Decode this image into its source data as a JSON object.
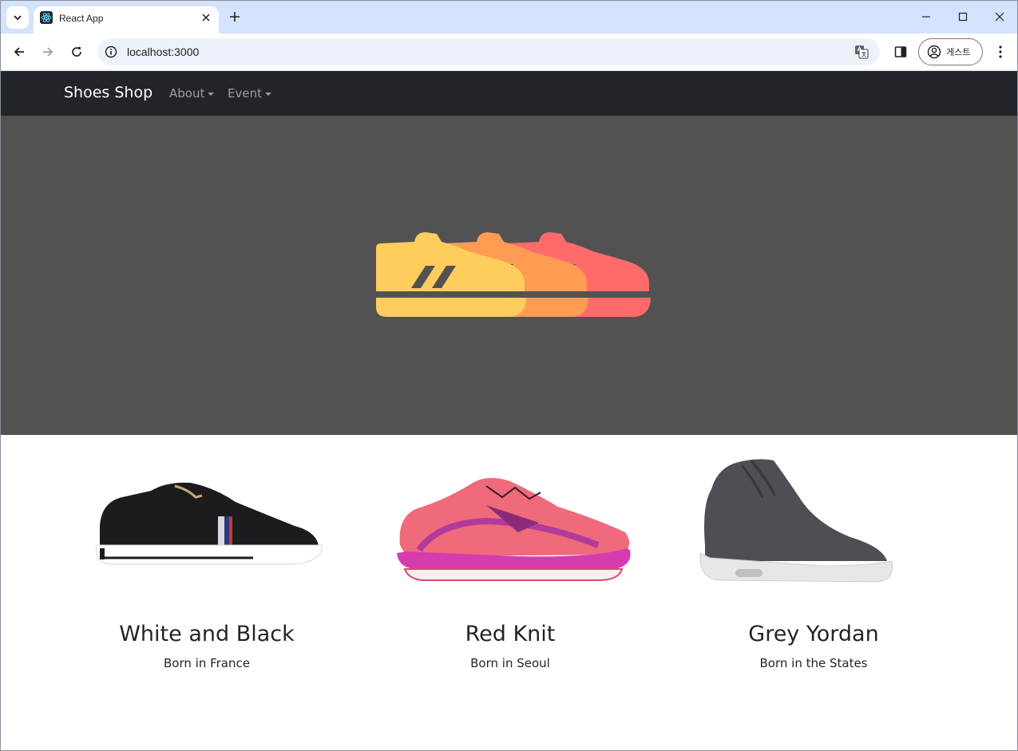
{
  "browser": {
    "tab_title": "React App",
    "url": "localhost:3000",
    "profile_label": "게스트"
  },
  "navbar": {
    "brand": "Shoes Shop",
    "links": [
      {
        "label": "About"
      },
      {
        "label": "Event"
      }
    ]
  },
  "hero": {
    "logo_colors": [
      "#ffcd5c",
      "#ff9b52",
      "#ff6b6b"
    ]
  },
  "products": [
    {
      "name": "White and Black",
      "origin": "Born in France"
    },
    {
      "name": "Red Knit",
      "origin": "Born in Seoul"
    },
    {
      "name": "Grey Yordan",
      "origin": "Born in the States"
    }
  ]
}
